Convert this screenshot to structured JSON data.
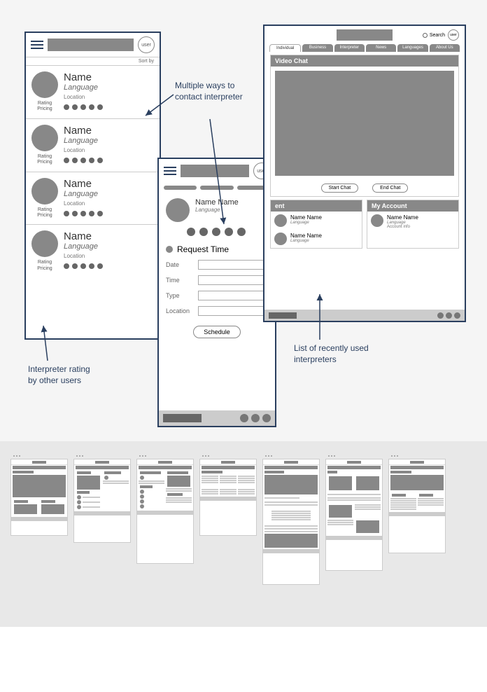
{
  "annotations": {
    "contact": "Multiple ways to contact interpreter",
    "rating": "Interpreter rating by other users",
    "recent": "List of recently used interpreters"
  },
  "mobile_list": {
    "user_label": "user",
    "sort_label": "Sort by",
    "items": [
      {
        "name": "Name",
        "language": "Language",
        "location": "Location",
        "rating": "Rating",
        "pricing": "Pricing"
      },
      {
        "name": "Name",
        "language": "Language",
        "location": "Location",
        "rating": "Rating",
        "pricing": "Pricing"
      },
      {
        "name": "Name",
        "language": "Language",
        "location": "Location",
        "rating": "Rating",
        "pricing": "Pricing"
      },
      {
        "name": "Name",
        "language": "Language",
        "location": "Location",
        "rating": "Rating",
        "pricing": "Pricing"
      }
    ]
  },
  "mobile_detail": {
    "user_label": "user",
    "name": "Name Name",
    "language": "Language",
    "request_title": "Request Time",
    "fields": {
      "date": "Date",
      "time": "Time",
      "type": "Type",
      "location": "Location"
    },
    "schedule": "Schedule"
  },
  "desktop": {
    "search": "Search",
    "user_label": "user",
    "nav": [
      "Individual",
      "Business",
      "Interpreter",
      "News",
      "Languages",
      "About Us"
    ],
    "video_title": "Video Chat",
    "start": "Start Chat",
    "end": "End Chat",
    "recent_title": "ent",
    "account_title": "My Account",
    "recent_items": [
      {
        "name": "Name Name",
        "language": "Language"
      },
      {
        "name": "Name Name",
        "language": "Language"
      }
    ],
    "account_item": {
      "name": "Name Name",
      "language": "Language",
      "info": "Account info"
    }
  }
}
